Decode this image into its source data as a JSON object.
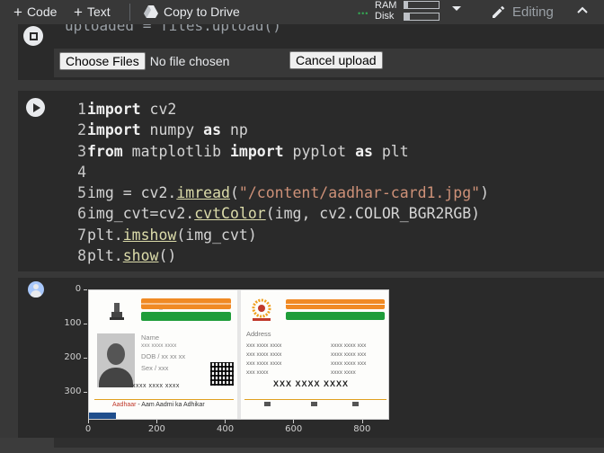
{
  "toolbar": {
    "add_code": "Code",
    "add_text": "Text",
    "copy_to_drive": "Copy to Drive",
    "ram_label": "RAM",
    "disk_label": "Disk",
    "ram_usage_fraction": 0.1,
    "disk_usage_fraction": 0.15,
    "editing_label": "Editing",
    "icons": [
      "plus-icon",
      "drive-icon",
      "connected-dots-icon",
      "caret-down-icon",
      "pencil-icon",
      "chevron-up-icon"
    ]
  },
  "upload_cell": {
    "code_fragment": "uploaded = files.upload()",
    "choose_files_label": "Choose Files",
    "file_status": "No file chosen",
    "cancel_upload_label": "Cancel upload"
  },
  "code_cell": {
    "line_numbers": [
      "1",
      "2",
      "3",
      "4",
      "5",
      "6",
      "7",
      "8"
    ],
    "lines": [
      [
        {
          "t": "kw",
          "v": "import"
        },
        {
          "t": "tx",
          "v": " cv2"
        }
      ],
      [
        {
          "t": "kw",
          "v": "import"
        },
        {
          "t": "tx",
          "v": " numpy "
        },
        {
          "t": "kw",
          "v": "as"
        },
        {
          "t": "tx",
          "v": " np"
        }
      ],
      [
        {
          "t": "kw",
          "v": "from"
        },
        {
          "t": "tx",
          "v": " matplotlib "
        },
        {
          "t": "kw",
          "v": "import"
        },
        {
          "t": "tx",
          "v": " pyplot "
        },
        {
          "t": "kw",
          "v": "as"
        },
        {
          "t": "tx",
          "v": " plt"
        }
      ],
      [],
      [
        {
          "t": "tx",
          "v": "img = cv2."
        },
        {
          "t": "fnul",
          "v": "imread"
        },
        {
          "t": "tx",
          "v": "("
        },
        {
          "t": "st",
          "v": "\"/content/aadhar-card1.jpg\""
        },
        {
          "t": "tx",
          "v": ")"
        }
      ],
      [
        {
          "t": "tx",
          "v": "img_cvt=cv2."
        },
        {
          "t": "fnul",
          "v": "cvtColor"
        },
        {
          "t": "tx",
          "v": "(img, cv2.COLOR_BGR2RGB)"
        }
      ],
      [
        {
          "t": "tx",
          "v": "plt."
        },
        {
          "t": "fnul",
          "v": "imshow"
        },
        {
          "t": "tx",
          "v": "(img_cvt)"
        }
      ],
      [
        {
          "t": "tx",
          "v": "plt."
        },
        {
          "t": "fnul",
          "v": "show"
        },
        {
          "t": "tx",
          "v": "()"
        }
      ]
    ]
  },
  "output_plot": {
    "x_ticks": [
      "0",
      "200",
      "400",
      "600",
      "800"
    ],
    "y_ticks": [
      "0",
      "100",
      "200",
      "300"
    ],
    "image": {
      "front": {
        "name_label": "Name",
        "dob_label": "DOB / xx xx xx",
        "sex_label": "Sex / xxx",
        "placeholder": "xxx xxxx xxxx",
        "uid": "xxxx xxxx xxxx",
        "footer_orange": "Aadhaar",
        "footer_text": " - Aam Aadmi ka Adhikar"
      },
      "back": {
        "address_label": "Address",
        "rows": [
          "xxx xxxx xxxx",
          "xxx xxxx xxxx",
          "xxx xxxx xxxx",
          "xxx xxxx"
        ],
        "rows_right": [
          "xxxx xxxx xxx",
          "xxxx xxxx xxx",
          "xxxx xxxx xxx",
          "xxxx xxxx"
        ],
        "uid": "XXX XXXX XXXX"
      }
    }
  }
}
